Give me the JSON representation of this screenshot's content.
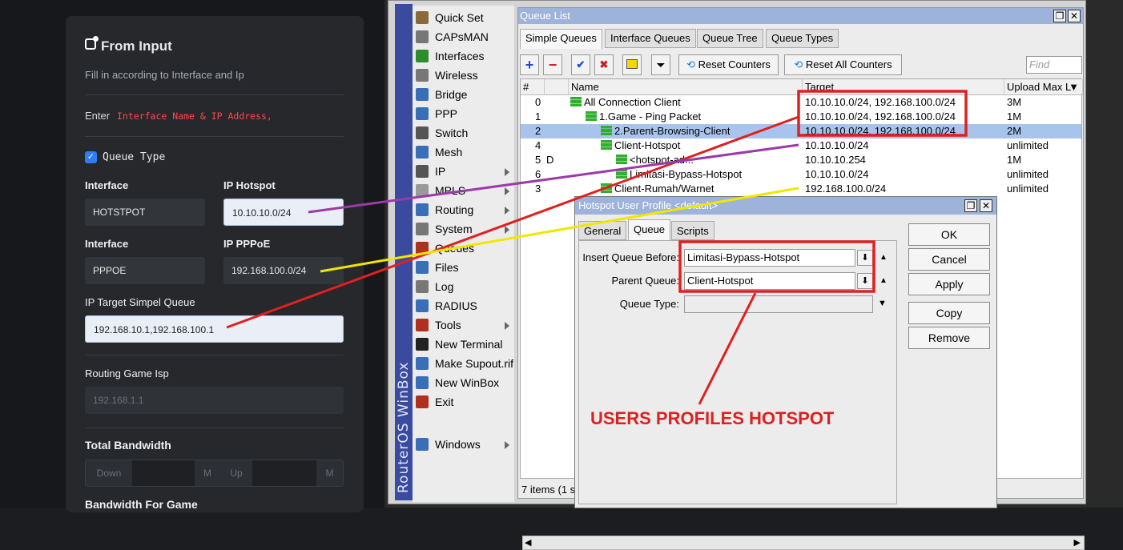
{
  "form": {
    "title": "From Input",
    "subtitle": "Fill in according to Interface and Ip",
    "enter_label": "Enter",
    "enter_hint": "Interface Name & IP Address,",
    "queue_type_label": "Queue Type",
    "queue_type_checked": true,
    "interface1_label": "Interface",
    "interface1_value": "HOTSTPOT",
    "ip_hotspot_label": "IP Hotspot",
    "ip_hotspot_value": "10.10.10.0/24",
    "interface2_label": "Interface",
    "interface2_value": "PPPOE",
    "ip_pppoe_label": "IP PPPoE",
    "ip_pppoe_value": "192.168.100.0/24",
    "target_label": "IP Target Simpel Queue",
    "target_value": "192.168.10.1,192.168.100.1",
    "routing_label": "Routing Game Isp",
    "routing_placeholder": "192.168.1.1",
    "bandwidth_label": "Total Bandwidth",
    "down_label": "Down",
    "m1": "M",
    "up_label": "Up",
    "m2": "M",
    "bandwidth_game_label": "Bandwidth For Game"
  },
  "winbox": {
    "side_label": "RouterOS WinBox",
    "menu": [
      {
        "label": "Quick Set",
        "icon": "wand-icon",
        "color": "#8a6a3a"
      },
      {
        "label": "CAPsMAN",
        "icon": "antenna-icon",
        "color": "#777777"
      },
      {
        "label": "Interfaces",
        "icon": "interfaces-icon",
        "color": "#2e8b2e"
      },
      {
        "label": "Wireless",
        "icon": "wireless-icon",
        "color": "#777777"
      },
      {
        "label": "Bridge",
        "icon": "bridge-icon",
        "color": "#3a6fb8"
      },
      {
        "label": "PPP",
        "icon": "ppp-icon",
        "color": "#3a6fb8"
      },
      {
        "label": "Switch",
        "icon": "switch-icon",
        "color": "#555555"
      },
      {
        "label": "Mesh",
        "icon": "mesh-icon",
        "color": "#3a6fb8"
      },
      {
        "label": "IP",
        "icon": "ip-icon",
        "color": "#555555"
      },
      {
        "label": "MPLS",
        "icon": "mpls-icon",
        "color": "#999999"
      },
      {
        "label": "Routing",
        "icon": "routing-icon",
        "color": "#3a6fb8"
      },
      {
        "label": "System",
        "icon": "system-icon",
        "color": "#777777"
      },
      {
        "label": "Queues",
        "icon": "queues-icon",
        "color": "#b03020"
      },
      {
        "label": "Files",
        "icon": "files-icon",
        "color": "#3a6fb8"
      },
      {
        "label": "Log",
        "icon": "log-icon",
        "color": "#777777"
      },
      {
        "label": "RADIUS",
        "icon": "radius-icon",
        "color": "#3a6fb8"
      },
      {
        "label": "Tools",
        "icon": "tools-icon",
        "color": "#b03020"
      },
      {
        "label": "New Terminal",
        "icon": "terminal-icon",
        "color": "#222222"
      },
      {
        "label": "Make Supout.rif",
        "icon": "supout-icon",
        "color": "#3a6fb8"
      },
      {
        "label": "New WinBox",
        "icon": "winbox-icon",
        "color": "#3a6fb8"
      },
      {
        "label": "Exit",
        "icon": "exit-icon",
        "color": "#b03020"
      },
      {
        "label": "Windows",
        "icon": "windows-icon",
        "color": "#3a6fb8"
      }
    ]
  },
  "queue_list": {
    "title": "Queue List",
    "tabs": [
      "Simple Queues",
      "Interface Queues",
      "Queue Tree",
      "Queue Types"
    ],
    "reset_counters": "Reset Counters",
    "reset_all_counters": "Reset All Counters",
    "find_placeholder": "Find",
    "columns": [
      "#",
      "Name",
      "Target",
      "Upload Max L"
    ],
    "rows": [
      {
        "num": "0",
        "flag": "",
        "name": "All Connection Client",
        "target": "10.10.10.0/24, 192.168.100.0/24",
        "upload": "3M"
      },
      {
        "num": "1",
        "flag": "",
        "name": "1.Game - Ping Packet",
        "target": "10.10.10.0/24, 192.168.100.0/24",
        "upload": "1M"
      },
      {
        "num": "2",
        "flag": "",
        "name": "2.Parent-Browsing-Client",
        "target": "10.10.10.0/24, 192.168.100.0/24",
        "upload": "2M"
      },
      {
        "num": "4",
        "flag": "",
        "name": "Client-Hotspot",
        "target": "10.10.10.0/24",
        "upload": "unlimited"
      },
      {
        "num": "5",
        "flag": "D",
        "name": "<hotspot-ad...",
        "target": "10.10.10.254",
        "upload": "1M"
      },
      {
        "num": "6",
        "flag": "",
        "name": "Limitasi-Bypass-Hotspot",
        "target": "10.10.10.0/24",
        "upload": "unlimited"
      },
      {
        "num": "3",
        "flag": "",
        "name": "Client-Rumah/Warnet",
        "target": "192.168.100.0/24",
        "upload": "unlimited"
      }
    ],
    "status": "7 items (1 s"
  },
  "hotspot_dialog": {
    "title": "Hotspot User Profile <default>",
    "tabs": [
      "General",
      "Queue",
      "Scripts"
    ],
    "insert_label": "Insert Queue Before:",
    "insert_value": "Limitasi-Bypass-Hotspot",
    "parent_label": "Parent Queue:",
    "parent_value": "Client-Hotspot",
    "type_label": "Queue Type:",
    "type_value": "",
    "buttons": [
      "OK",
      "Cancel",
      "Apply",
      "Copy",
      "Remove"
    ]
  },
  "annotation": {
    "text": "USERS PROFILES HOTSPOT",
    "red": "#e02020",
    "purple": "#9b3aa8",
    "yellow": "#f2e600"
  }
}
